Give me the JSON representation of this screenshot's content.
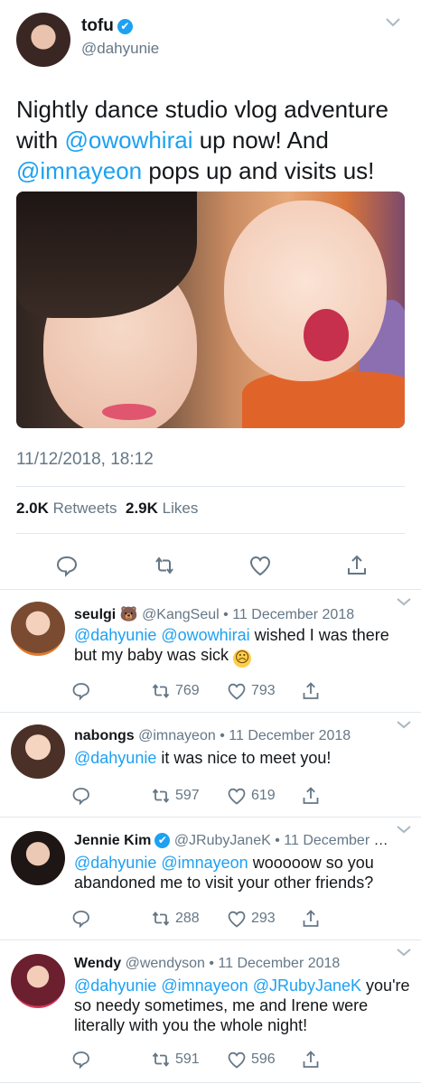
{
  "main_tweet": {
    "display_name": "tofu",
    "handle": "@dahyunie",
    "text_parts": [
      {
        "t": "Nightly dance studio vlog adventure with ",
        "link": false
      },
      {
        "t": "@owowhirai",
        "link": true
      },
      {
        "t": " up now! And ",
        "link": false
      },
      {
        "t": "@imnayeon",
        "link": true
      },
      {
        "t": " pops up and visits us!",
        "link": false
      }
    ],
    "timestamp": "11/12/2018, 18:12",
    "retweets_count": "2.0K",
    "retweets_label": "Retweets",
    "likes_count": "2.9K",
    "likes_label": "Likes"
  },
  "replies": [
    {
      "name": "seulgi",
      "emoji": "🐻",
      "verified": false,
      "handle": "@KangSeul",
      "date": "11 December 2018",
      "text_parts": [
        {
          "t": "@dahyunie",
          "link": true
        },
        {
          "t": " ",
          "link": false
        },
        {
          "t": "@owowhirai",
          "link": true
        },
        {
          "t": " wished I was there but my baby was sick ",
          "link": false
        },
        {
          "t": "☹",
          "link": false,
          "emoji": true
        }
      ],
      "retweets": "769",
      "likes": "793"
    },
    {
      "name": "nabongs",
      "emoji": "",
      "verified": false,
      "handle": "@imnayeon",
      "date": "11 December 2018",
      "text_parts": [
        {
          "t": "@dahyunie",
          "link": true
        },
        {
          "t": " it was nice to meet you!",
          "link": false
        }
      ],
      "retweets": "597",
      "likes": "619"
    },
    {
      "name": "Jennie Kim",
      "emoji": "",
      "verified": true,
      "handle": "@JRubyJaneK",
      "date": "11 December 2...",
      "text_parts": [
        {
          "t": "@dahyunie",
          "link": true
        },
        {
          "t": " ",
          "link": false
        },
        {
          "t": "@imnayeon",
          "link": true
        },
        {
          "t": " wooooow so you abandoned me to visit your other friends?",
          "link": false
        }
      ],
      "retweets": "288",
      "likes": "293"
    },
    {
      "name": "Wendy",
      "emoji": "",
      "verified": false,
      "handle": "@wendyson",
      "date": "11 December 2018",
      "text_parts": [
        {
          "t": "@dahyunie",
          "link": true
        },
        {
          "t": " ",
          "link": false
        },
        {
          "t": "@imnayeon",
          "link": true
        },
        {
          "t": " ",
          "link": false
        },
        {
          "t": "@JRubyJaneK",
          "link": true
        },
        {
          "t": " you're so needy sometimes, me and Irene were literally with you the whole night!",
          "link": false
        }
      ],
      "retweets": "591",
      "likes": "596"
    }
  ],
  "separator": "•",
  "verified_glyph": "✔",
  "colors": {
    "link": "#1da1f2",
    "muted": "#657786",
    "text": "#14171a",
    "divider": "#e1e8ed"
  }
}
